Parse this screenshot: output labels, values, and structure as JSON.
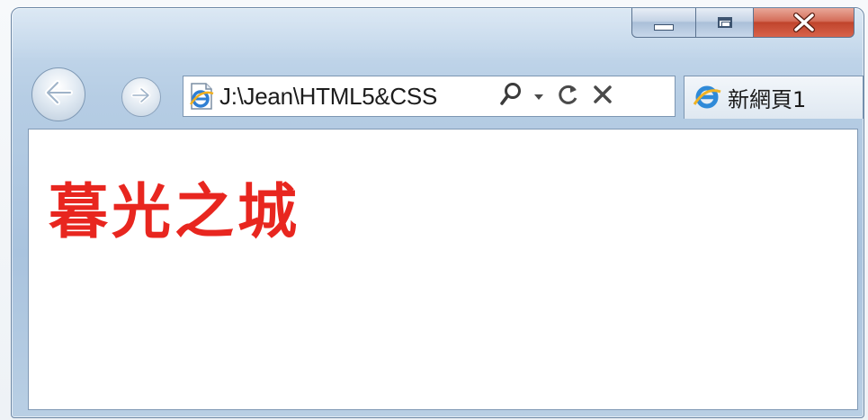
{
  "window": {
    "caption_buttons": {
      "minimize_icon": "minimize-icon",
      "maximize_icon": "maximize-icon",
      "close_icon": "close-icon"
    }
  },
  "navbar": {
    "back_icon": "back-arrow-icon",
    "forward_icon": "forward-arrow-icon",
    "address": {
      "site_icon": "ie-page-icon",
      "value": "J:\\Jean\\HTML5&CSS",
      "search_icon": "search-icon",
      "dropdown_icon": "dropdown-arrow-icon",
      "refresh_icon": "refresh-icon",
      "stop_icon": "stop-icon"
    },
    "tab": {
      "icon": "ie-logo-icon",
      "label": "新網頁1"
    }
  },
  "page": {
    "heading": "暮光之城",
    "heading_color": "#e8261f"
  },
  "colors": {
    "frame": "#b6cde4",
    "close_button": "#c9452d"
  }
}
